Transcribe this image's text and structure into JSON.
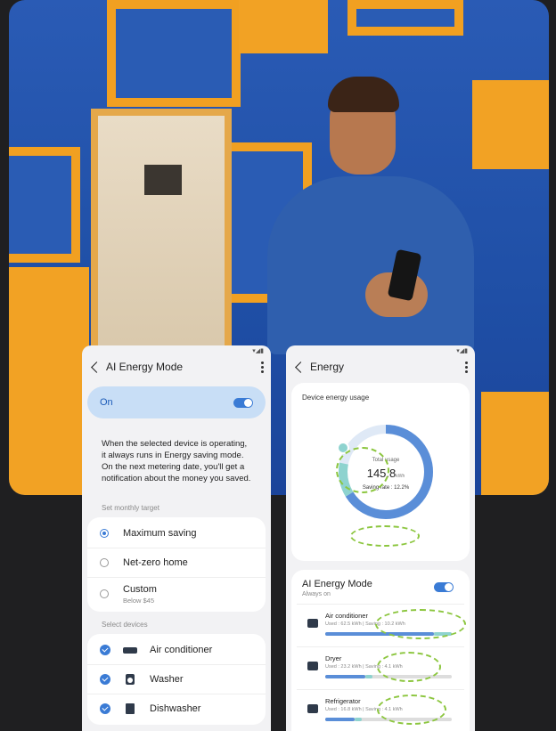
{
  "left_screen": {
    "title": "AI Energy Mode",
    "on_label": "On",
    "description": "When the selected device is operating, it always runs in Energy saving mode. On the next metering date, you'll get a notification about the money you saved.",
    "target_section": "Set monthly target",
    "targets": [
      {
        "label": "Maximum saving",
        "selected": true
      },
      {
        "label": "Net-zero home",
        "selected": false
      },
      {
        "label": "Custom",
        "sub": "Below $45",
        "selected": false
      }
    ],
    "devices_section": "Select devices",
    "devices": [
      {
        "label": "Air conditioner",
        "icon": "air-conditioner-icon"
      },
      {
        "label": "Washer",
        "icon": "washer-icon"
      },
      {
        "label": "Dishwasher",
        "icon": "dishwasher-icon"
      }
    ]
  },
  "right_screen": {
    "title": "Energy",
    "usage_title": "Device energy usage",
    "total_label": "Total usage",
    "total_value": "145.8",
    "total_unit": "kWh",
    "saving_rate": "Saving rate : 12.2%",
    "ai_mode_title": "AI Energy Mode",
    "ai_mode_sub": "Always on",
    "devices": [
      {
        "name": "Air conditioner",
        "stats": "Used : 62.5 kWh | Saving : 10.2 kWh",
        "used": 62.5,
        "saving": 10.2,
        "icon": "air-conditioner-icon"
      },
      {
        "name": "Dryer",
        "stats": "Used : 23.2 kWh | Saving : 4.1 kWh",
        "used": 23.2,
        "saving": 4.1,
        "icon": "dryer-icon"
      },
      {
        "name": "Refrigerator",
        "stats": "Used : 16.8 kWh | Saving : 4.1 kWh",
        "used": 16.8,
        "saving": 4.1,
        "icon": "refrigerator-icon"
      }
    ]
  },
  "colors": {
    "accent": "#3a7bd5",
    "highlight": "#8cc63f",
    "saving": "#8ed3cf"
  }
}
